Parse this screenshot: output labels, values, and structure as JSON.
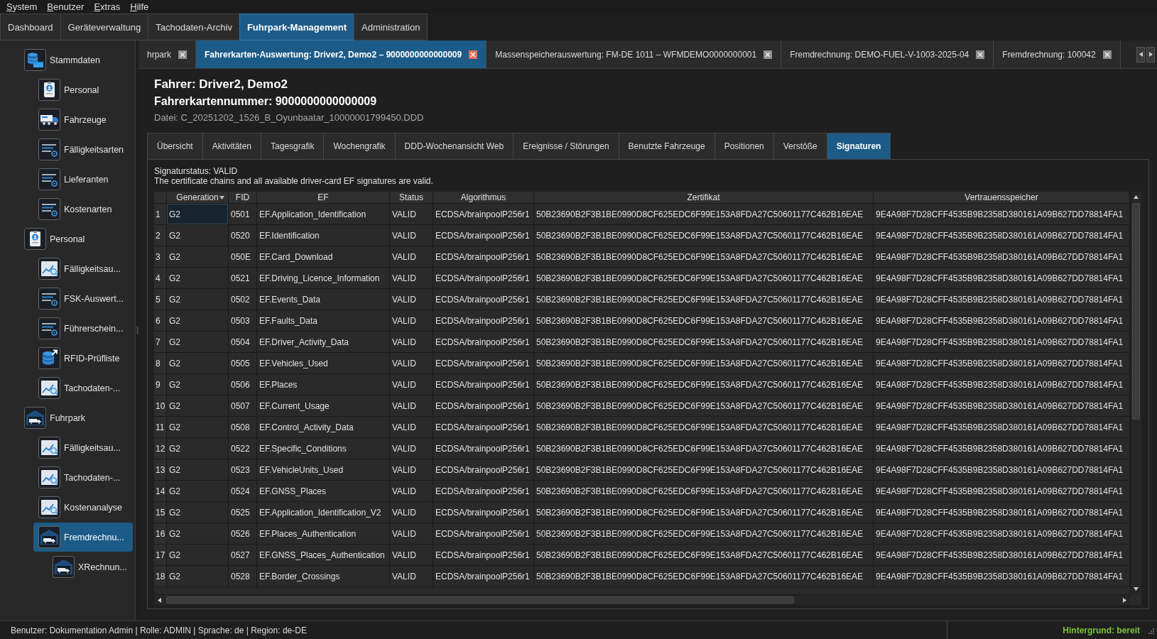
{
  "menu_bar": {
    "items": [
      "System",
      "Benutzer",
      "Extras",
      "Hilfe"
    ]
  },
  "main_tabs": [
    {
      "label": "Dashboard",
      "selected": false
    },
    {
      "label": "Geräteverwaltung",
      "selected": false
    },
    {
      "label": "Tachodaten-Archiv",
      "selected": false
    },
    {
      "label": "Fuhrpark-Management",
      "selected": true
    },
    {
      "label": "Administration",
      "selected": false
    }
  ],
  "sidebar": {
    "items": [
      {
        "label": "Stammdaten",
        "kind": "masterdata",
        "selected": false,
        "children": [
          {
            "label": "Personal",
            "kind": "person",
            "selected": false
          },
          {
            "label": "Fahrzeuge",
            "kind": "vehicle",
            "selected": false
          },
          {
            "label": "Fälligkeitsarten",
            "kind": "catalog",
            "selected": false
          },
          {
            "label": "Lieferanten",
            "kind": "catalog",
            "selected": false
          },
          {
            "label": "Kostenarten",
            "kind": "catalog",
            "selected": false
          }
        ]
      },
      {
        "label": "Personal",
        "kind": "person",
        "selected": false,
        "children": [
          {
            "label": "Fälligkeitsau...",
            "kind": "analysis",
            "selected": false
          },
          {
            "label": "FSK-Auswert...",
            "kind": "catalog",
            "selected": false
          },
          {
            "label": "Führerschein...",
            "kind": "catalog",
            "selected": false
          },
          {
            "label": "RFID-Prüfliste",
            "kind": "import",
            "selected": false
          },
          {
            "label": "Tachodaten-...",
            "kind": "analysis",
            "selected": false
          }
        ]
      },
      {
        "label": "Fuhrpark",
        "kind": "fleet",
        "selected": false,
        "children": [
          {
            "label": "Fälligkeitsau...",
            "kind": "analysis",
            "selected": false
          },
          {
            "label": "Tachodaten-...",
            "kind": "analysis",
            "selected": false
          },
          {
            "label": "Kostenanalyse",
            "kind": "analysis",
            "selected": false
          },
          {
            "label": "Fremdrechnu...",
            "kind": "fleet",
            "selected": true,
            "children": [
              {
                "label": "XRechnun...",
                "kind": "fleet",
                "selected": false
              }
            ]
          }
        ]
      }
    ]
  },
  "document_tabs": [
    {
      "label": "hrpark",
      "selected": false
    },
    {
      "label": "Fahrerkarten-Auswertung: Driver2, Demo2 – 9000000000000009",
      "selected": true
    },
    {
      "label": "Massenspeicherauswertung: FM-DE 1011 – WFMDEMO0000000001",
      "selected": false
    },
    {
      "label": "Fremdrechnung: DEMO-FUEL-V-1003-2025-04",
      "selected": false
    },
    {
      "label": "Fremdrechnung: 100042",
      "selected": false
    }
  ],
  "header": {
    "driver": "Fahrer: Driver2, Demo2",
    "card_number": "Fahrerkartennummer: 9000000000000009",
    "file": "Datei: C_20251202_1526_B_Oyunbaatar_10000001799450.DDD"
  },
  "sub_tabs": [
    {
      "label": "Übersicht",
      "selected": false
    },
    {
      "label": "Aktivitäten",
      "selected": false
    },
    {
      "label": "Tagesgrafik",
      "selected": false
    },
    {
      "label": "Wochengrafik",
      "selected": false
    },
    {
      "label": "DDD-Wochenansicht Web",
      "selected": false
    },
    {
      "label": "Ereignisse / Störungen",
      "selected": false
    },
    {
      "label": "Benutzte Fahrzeuge",
      "selected": false
    },
    {
      "label": "Positionen",
      "selected": false
    },
    {
      "label": "Verstöße",
      "selected": false
    },
    {
      "label": "Signaturen",
      "selected": true
    }
  ],
  "signatures": {
    "status": "Signaturstatus: VALID",
    "message": "The certificate chains and all available driver-card EF signatures are valid.",
    "table": {
      "columns": [
        {
          "label": "Generation",
          "sorted": true
        },
        {
          "label": "FID",
          "sorted": false
        },
        {
          "label": "EF",
          "sorted": false
        },
        {
          "label": "Status",
          "sorted": false
        },
        {
          "label": "Algorithmus",
          "sorted": false
        },
        {
          "label": "Zertifikat",
          "sorted": false
        },
        {
          "label": "Vertrauensspeicher",
          "sorted": false
        }
      ],
      "rows": [
        {
          "number": "1",
          "focused": true,
          "cells": [
            "G2",
            "0501",
            "EF.Application_Identification",
            "VALID",
            "ECDSA/brainpoolP256r1",
            "50B23690B2F3B1BE0990D8CF625EDC6F99E153A8FDA27C50601177C462B16EAE",
            "9E4A98F7D28CFF4535B9B2358D380161A09B627DD78814FA1"
          ]
        },
        {
          "number": "2",
          "focused": false,
          "cells": [
            "G2",
            "0520",
            "EF.Identification",
            "VALID",
            "ECDSA/brainpoolP256r1",
            "50B23690B2F3B1BE0990D8CF625EDC6F99E153A8FDA27C50601177C462B16EAE",
            "9E4A98F7D28CFF4535B9B2358D380161A09B627DD78814FA1"
          ]
        },
        {
          "number": "3",
          "focused": false,
          "cells": [
            "G2",
            "050E",
            "EF.Card_Download",
            "VALID",
            "ECDSA/brainpoolP256r1",
            "50B23690B2F3B1BE0990D8CF625EDC6F99E153A8FDA27C50601177C462B16EAE",
            "9E4A98F7D28CFF4535B9B2358D380161A09B627DD78814FA1"
          ]
        },
        {
          "number": "4",
          "focused": false,
          "cells": [
            "G2",
            "0521",
            "EF.Driving_Licence_Information",
            "VALID",
            "ECDSA/brainpoolP256r1",
            "50B23690B2F3B1BE0990D8CF625EDC6F99E153A8FDA27C50601177C462B16EAE",
            "9E4A98F7D28CFF4535B9B2358D380161A09B627DD78814FA1"
          ]
        },
        {
          "number": "5",
          "focused": false,
          "cells": [
            "G2",
            "0502",
            "EF.Events_Data",
            "VALID",
            "ECDSA/brainpoolP256r1",
            "50B23690B2F3B1BE0990D8CF625EDC6F99E153A8FDA27C50601177C462B16EAE",
            "9E4A98F7D28CFF4535B9B2358D380161A09B627DD78814FA1"
          ]
        },
        {
          "number": "6",
          "focused": false,
          "cells": [
            "G2",
            "0503",
            "EF.Faults_Data",
            "VALID",
            "ECDSA/brainpoolP256r1",
            "50B23690B2F3B1BE0990D8CF625EDC6F99E153A8FDA27C50601177C462B16EAE",
            "9E4A98F7D28CFF4535B9B2358D380161A09B627DD78814FA1"
          ]
        },
        {
          "number": "7",
          "focused": false,
          "cells": [
            "G2",
            "0504",
            "EF.Driver_Activity_Data",
            "VALID",
            "ECDSA/brainpoolP256r1",
            "50B23690B2F3B1BE0990D8CF625EDC6F99E153A8FDA27C50601177C462B16EAE",
            "9E4A98F7D28CFF4535B9B2358D380161A09B627DD78814FA1"
          ]
        },
        {
          "number": "8",
          "focused": false,
          "cells": [
            "G2",
            "0505",
            "EF.Vehicles_Used",
            "VALID",
            "ECDSA/brainpoolP256r1",
            "50B23690B2F3B1BE0990D8CF625EDC6F99E153A8FDA27C50601177C462B16EAE",
            "9E4A98F7D28CFF4535B9B2358D380161A09B627DD78814FA1"
          ]
        },
        {
          "number": "9",
          "focused": false,
          "cells": [
            "G2",
            "0506",
            "EF.Places",
            "VALID",
            "ECDSA/brainpoolP256r1",
            "50B23690B2F3B1BE0990D8CF625EDC6F99E153A8FDA27C50601177C462B16EAE",
            "9E4A98F7D28CFF4535B9B2358D380161A09B627DD78814FA1"
          ]
        },
        {
          "number": "10",
          "focused": false,
          "cells": [
            "G2",
            "0507",
            "EF.Current_Usage",
            "VALID",
            "ECDSA/brainpoolP256r1",
            "50B23690B2F3B1BE0990D8CF625EDC6F99E153A8FDA27C50601177C462B16EAE",
            "9E4A98F7D28CFF4535B9B2358D380161A09B627DD78814FA1"
          ]
        },
        {
          "number": "11",
          "focused": false,
          "cells": [
            "G2",
            "0508",
            "EF.Control_Activity_Data",
            "VALID",
            "ECDSA/brainpoolP256r1",
            "50B23690B2F3B1BE0990D8CF625EDC6F99E153A8FDA27C50601177C462B16EAE",
            "9E4A98F7D28CFF4535B9B2358D380161A09B627DD78814FA1"
          ]
        },
        {
          "number": "12",
          "focused": false,
          "cells": [
            "G2",
            "0522",
            "EF.Specific_Conditions",
            "VALID",
            "ECDSA/brainpoolP256r1",
            "50B23690B2F3B1BE0990D8CF625EDC6F99E153A8FDA27C50601177C462B16EAE",
            "9E4A98F7D28CFF4535B9B2358D380161A09B627DD78814FA1"
          ]
        },
        {
          "number": "13",
          "focused": false,
          "cells": [
            "G2",
            "0523",
            "EF.VehicleUnits_Used",
            "VALID",
            "ECDSA/brainpoolP256r1",
            "50B23690B2F3B1BE0990D8CF625EDC6F99E153A8FDA27C50601177C462B16EAE",
            "9E4A98F7D28CFF4535B9B2358D380161A09B627DD78814FA1"
          ]
        },
        {
          "number": "14",
          "focused": false,
          "cells": [
            "G2",
            "0524",
            "EF.GNSS_Places",
            "VALID",
            "ECDSA/brainpoolP256r1",
            "50B23690B2F3B1BE0990D8CF625EDC6F99E153A8FDA27C50601177C462B16EAE",
            "9E4A98F7D28CFF4535B9B2358D380161A09B627DD78814FA1"
          ]
        },
        {
          "number": "15",
          "focused": false,
          "cells": [
            "G2",
            "0525",
            "EF.Application_Identification_V2",
            "VALID",
            "ECDSA/brainpoolP256r1",
            "50B23690B2F3B1BE0990D8CF625EDC6F99E153A8FDA27C50601177C462B16EAE",
            "9E4A98F7D28CFF4535B9B2358D380161A09B627DD78814FA1"
          ]
        },
        {
          "number": "16",
          "focused": false,
          "cells": [
            "G2",
            "0526",
            "EF.Places_Authentication",
            "VALID",
            "ECDSA/brainpoolP256r1",
            "50B23690B2F3B1BE0990D8CF625EDC6F99E153A8FDA27C50601177C462B16EAE",
            "9E4A98F7D28CFF4535B9B2358D380161A09B627DD78814FA1"
          ]
        },
        {
          "number": "17",
          "focused": false,
          "cells": [
            "G2",
            "0527",
            "EF.GNSS_Places_Authentication",
            "VALID",
            "ECDSA/brainpoolP256r1",
            "50B23690B2F3B1BE0990D8CF625EDC6F99E153A8FDA27C50601177C462B16EAE",
            "9E4A98F7D28CFF4535B9B2358D380161A09B627DD78814FA1"
          ]
        },
        {
          "number": "18",
          "focused": false,
          "cells": [
            "G2",
            "0528",
            "EF.Border_Crossings",
            "VALID",
            "ECDSA/brainpoolP256r1",
            "50B23690B2F3B1BE0990D8CF625EDC6F99E153A8FDA27C50601177C462B16EAE",
            "9E4A98F7D28CFF4535B9B2358D380161A09B627DD78814FA1"
          ]
        }
      ]
    }
  },
  "status_bar": {
    "session": "Benutzer: Dokumentation Admin | Rolle: ADMIN | Sprache: de | Region: de-DE",
    "background": "Hintergrund: bereit"
  }
}
